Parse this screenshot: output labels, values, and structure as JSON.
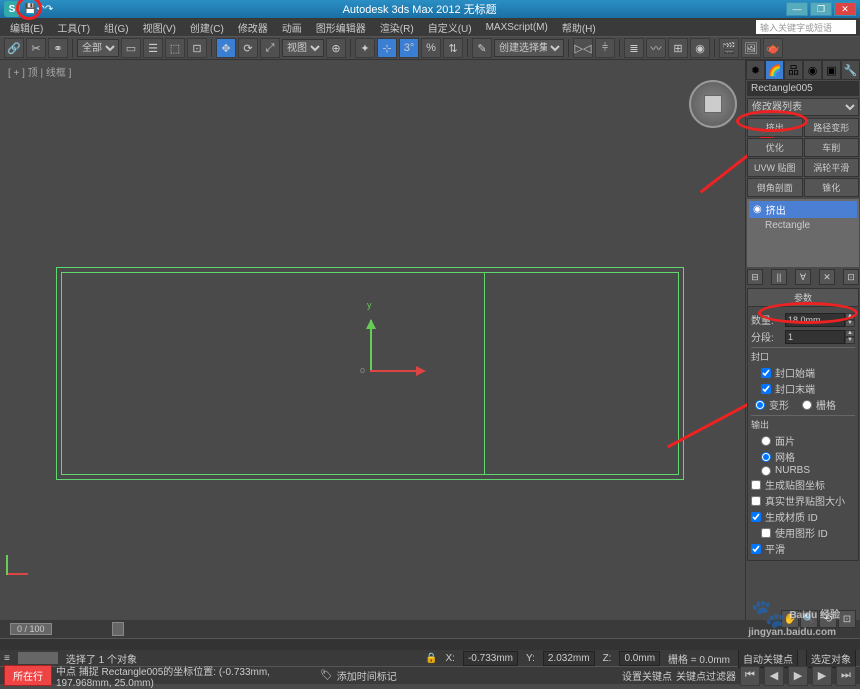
{
  "title": "Autodesk 3ds Max 2012      无标题",
  "logo": "S",
  "winbtns": {
    "min": "—",
    "max": "❐",
    "close": "✕"
  },
  "menu": [
    "编辑(E)",
    "工具(T)",
    "组(G)",
    "视图(V)",
    "创建(C)",
    "修改器",
    "动画",
    "图形编辑器",
    "渲染(R)",
    "自定义(U)",
    "MAXScript(M)",
    "帮助(H)"
  ],
  "search_placeholder": "输入关键字或短语",
  "toolbar2": {
    "dropdown": "全部",
    "viewdd": "视图",
    "createdd": "创建选择集"
  },
  "vplabel": "[ + ] 顶 | 线框 ]",
  "gizmo": {
    "y": "y",
    "o": "o"
  },
  "cmd": {
    "objname": "Rectangle005",
    "modlist": "修改器列表",
    "grid": [
      "挤出",
      "路径变形",
      "优化",
      "车削",
      "UVW 贴图",
      "涡轮平滑",
      "倒角剖面",
      "锥化"
    ],
    "stack": [
      {
        "icon": "◉",
        "label": "挤出",
        "sel": true
      },
      {
        "icon": "",
        "label": "Rectangle",
        "sel": false
      }
    ],
    "stackbtns": [
      "⊟",
      "||",
      "∀",
      "✕",
      "⊡"
    ]
  },
  "params": {
    "header": "参数",
    "amount_lbl": "数量:",
    "amount_val": "18.0mm",
    "seg_lbl": "分段:",
    "seg_val": "1",
    "cap_hdr": "封口",
    "cap_start": "封口始端",
    "cap_end": "封口末端",
    "morph": "变形",
    "grid": "栅格",
    "out_hdr": "输出",
    "patch": "面片",
    "mesh": "网格",
    "nurbs": "NURBS",
    "genmap": "生成贴图坐标",
    "realworld": "真实世界贴图大小",
    "genmatid": "生成材质 ID",
    "usemapid": "使用图形 ID",
    "smooth": "平滑"
  },
  "time": {
    "slider": "0 / 100"
  },
  "status": {
    "sel": "选择了 1 个对象",
    "x_lbl": "X:",
    "x": "-0.733mm",
    "y_lbl": "Y:",
    "y": "2.032mm",
    "z_lbl": "Z:",
    "z": "0.0mm",
    "grid_lbl": "栅格 = 0.0mm",
    "autokey": "自动关键点",
    "selset": "选定对象",
    "tip": "中点 捕捉 Rectangle005的坐标位置:  (-0.733mm, 197.968mm, 25.0mm)",
    "live": "所在行",
    "addtag": "添加时间标记",
    "setkey": "设置关键点",
    "keyfilter": "关键点过滤器"
  },
  "watermark": {
    "main": "Baidu 经验",
    "sub": "jingyan.baidu.com"
  }
}
